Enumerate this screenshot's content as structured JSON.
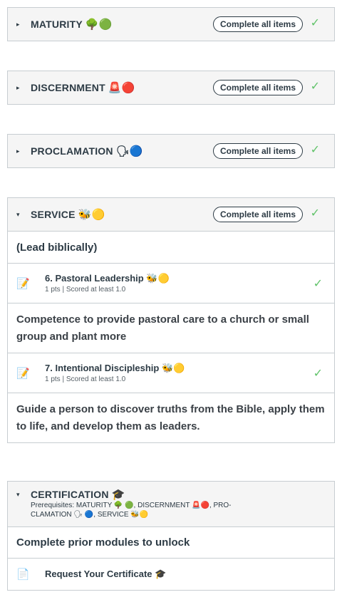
{
  "modules": [
    {
      "title": "MATURITY",
      "emoji": "🌳🟢",
      "requirement": "Complete all items"
    },
    {
      "title": "DISCERNMENT",
      "emoji": "🚨🔴",
      "requirement": "Complete all items"
    },
    {
      "title": "PROCLAMATION",
      "emoji": "🗣🔵",
      "requirement": "Complete all items"
    },
    {
      "title": "SERVICE",
      "emoji": "🐝🟡",
      "requirement": "Complete all items"
    }
  ],
  "service": {
    "subheader": "(Lead biblically)",
    "items": [
      {
        "title": "6. Pastoral Leadership",
        "emoji": "🐝🟡",
        "points": "1 pts",
        "score": "Scored at least 1.0"
      },
      {
        "title": "7. Intentional Discipleship",
        "emoji": "🐝🟡",
        "points": "1 pts",
        "score": "Scored at least 1.0"
      }
    ],
    "desc1": "Competence to provide pastoral care to a church or small group and plant more",
    "desc2": "Guide a person to discover truths from the Bible, apply them to life, and develop them as leaders."
  },
  "certification": {
    "title": "CERTIFICATION",
    "emoji": "🎓",
    "prereq_line1": "Prerequisites: MATURITY 🌳 🟢, DISCERNMENT 🚨🔴, PRO-",
    "prereq_line2": "CLAMATION 🗣 🔵, SERVICE 🐝🟡",
    "locked_text": "Complete prior modules to unlock",
    "item_title": "Request Your Certificate 🎓"
  },
  "icons": {
    "collapsed": "▸",
    "expanded": "▾",
    "check": "✓",
    "assignment": "📝",
    "page": "📄"
  },
  "colors": {
    "check": "#61c36a",
    "header_bg": "#f5f5f5",
    "border": "#c7cdd1"
  }
}
